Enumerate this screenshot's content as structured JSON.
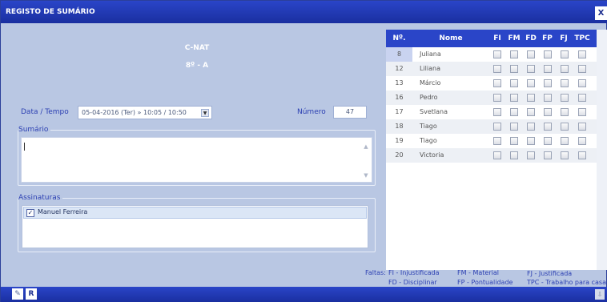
{
  "window": {
    "title": "REGISTO DE SUMÁRIO",
    "close_label": "X"
  },
  "course": {
    "subject": "C-NAT",
    "class": "8º - A"
  },
  "form": {
    "datetime_label": "Data / Tempo",
    "datetime_value": "05-04-2016 (Ter) » 10:05 / 10:50",
    "number_label": "Número",
    "number_value": "47",
    "summary_label": "Sumário",
    "summary_value": "",
    "signatures_label": "Assinaturas",
    "signatures": [
      {
        "name": "Manuel Ferreira",
        "checked": true
      }
    ]
  },
  "table": {
    "headers": [
      "Nº.",
      "Nome",
      "FI",
      "FM",
      "FD",
      "FP",
      "FJ",
      "TPC"
    ],
    "rows": [
      {
        "num": "8",
        "name": "Juliana"
      },
      {
        "num": "12",
        "name": "Liliana"
      },
      {
        "num": "13",
        "name": "Márcio"
      },
      {
        "num": "16",
        "name": "Pedro"
      },
      {
        "num": "17",
        "name": "Svetlana"
      },
      {
        "num": "18",
        "name": "Tiago"
      },
      {
        "num": "19",
        "name": "Tiago"
      },
      {
        "num": "20",
        "name": "Victoria"
      }
    ]
  },
  "legend": {
    "title": "Faltas:",
    "items": [
      "FI - Injustificada",
      "FM - Material",
      "FJ - Justificada",
      "FD - Disciplinar",
      "FP - Pontualidade",
      "TPC - Trabalho para casa"
    ]
  },
  "statusbar": {
    "r_label": "R",
    "attach_icon": "paperclip-icon",
    "download_icon": "download-icon"
  },
  "colors": {
    "titlebar": "#2a45c8",
    "panel": "#b9c7e3",
    "label": "#2b3fb2"
  }
}
